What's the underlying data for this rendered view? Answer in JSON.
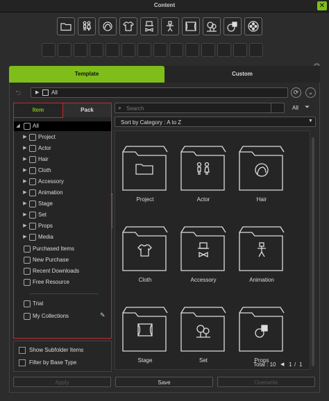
{
  "window": {
    "title": "Content",
    "close_label": "✕"
  },
  "category_icons": [
    "folder-icon",
    "actor-icon",
    "hair-icon",
    "cloth-icon",
    "accessory-icon",
    "animation-icon",
    "stage-icon",
    "set-icon",
    "props-icon",
    "media-icon"
  ],
  "main_tabs": {
    "template": "Template",
    "custom": "Custom"
  },
  "path": {
    "label": "All"
  },
  "left_tabs": {
    "item": "Item",
    "pack": "Pack"
  },
  "tree": [
    {
      "label": "All",
      "icon": "all-icon"
    },
    {
      "label": "Project",
      "icon": "folder-icon"
    },
    {
      "label": "Actor",
      "icon": "actor-icon"
    },
    {
      "label": "Hair",
      "icon": "hair-icon"
    },
    {
      "label": "Cloth",
      "icon": "cloth-icon"
    },
    {
      "label": "Accessory",
      "icon": "accessory-icon"
    },
    {
      "label": "Animation",
      "icon": "animation-icon"
    },
    {
      "label": "Stage",
      "icon": "stage-icon"
    },
    {
      "label": "Set",
      "icon": "set-icon"
    },
    {
      "label": "Props",
      "icon": "props-icon"
    },
    {
      "label": "Media",
      "icon": "media-icon"
    },
    {
      "label": "Purchased Items",
      "icon": "purchased-icon"
    },
    {
      "label": "New Purchase",
      "icon": "new-purchase-icon"
    },
    {
      "label": "Recent Downloads",
      "icon": "download-icon"
    },
    {
      "label": "Free Resource",
      "icon": "gift-icon"
    },
    {
      "label": "Trial",
      "icon": "trial-icon"
    },
    {
      "label": "My Collections",
      "icon": "tag-icon"
    }
  ],
  "options": {
    "show_subfolder": "Show Subfolder Items",
    "filter_base": "Filter by Base Type"
  },
  "search": {
    "placeholder": "Search",
    "filter_value": "All"
  },
  "sort": {
    "label": "Sort by Category : A to Z"
  },
  "grid_items": [
    "Project",
    "Actor",
    "Hair",
    "Cloth",
    "Accessory",
    "Animation",
    "Stage",
    "Set",
    "Props"
  ],
  "pager": {
    "total": "Total : 10",
    "page": "1",
    "separator": "/",
    "pages": "1"
  },
  "buttons": {
    "apply": "Apply",
    "save": "Save",
    "overwrite": "Overwrite"
  },
  "colors": {
    "accent": "#7fbe1a",
    "highlight_border": "#c8282a",
    "background": "#2c2c2c"
  }
}
